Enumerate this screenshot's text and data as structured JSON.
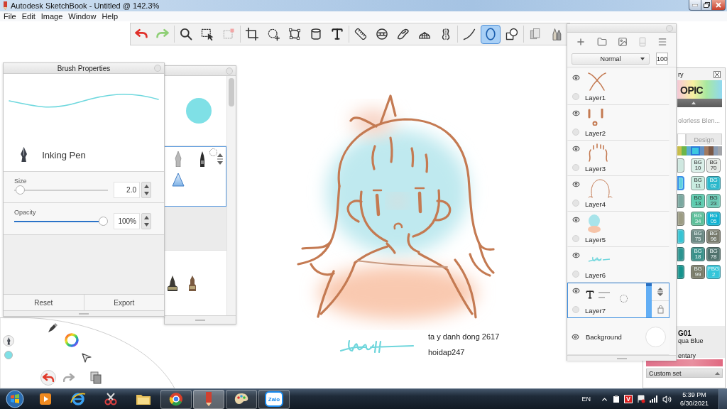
{
  "window": {
    "title": "Autodesk SketchBook - Untitled @ 142.3%"
  },
  "menu": [
    "File",
    "Edit",
    "Image",
    "Window",
    "Help"
  ],
  "toolbar": {
    "tools": [
      {
        "kind": "undo",
        "selected": false
      },
      {
        "kind": "redo",
        "selected": false
      },
      {
        "kind": "zoom",
        "selected": false
      },
      {
        "kind": "select",
        "selected": false
      },
      {
        "kind": "deselect",
        "selected": false
      },
      {
        "kind": "crop",
        "selected": false
      },
      {
        "kind": "transform",
        "selected": false
      },
      {
        "kind": "distort",
        "selected": false
      },
      {
        "kind": "cylinder",
        "selected": false
      },
      {
        "kind": "text",
        "selected": false
      },
      {
        "kind": "ruler",
        "selected": false
      },
      {
        "kind": "guide",
        "selected": false
      },
      {
        "kind": "curve",
        "selected": false
      },
      {
        "kind": "perspective",
        "selected": false
      },
      {
        "kind": "symmetry",
        "selected": false
      },
      {
        "kind": "stroke",
        "selected": false
      },
      {
        "kind": "ellipse",
        "selected": true
      },
      {
        "kind": "shapes",
        "selected": false
      },
      {
        "kind": "markers",
        "selected": false
      },
      {
        "kind": "brushes",
        "selected": false
      }
    ]
  },
  "brush_properties": {
    "title": "Brush Properties",
    "brush": "Inking Pen",
    "size": {
      "label": "Size",
      "value": "2.0",
      "level": 0.02
    },
    "opacity": {
      "label": "Opacity",
      "value": "100%",
      "level": 1
    },
    "buttons": [
      "Reset",
      "Export"
    ]
  },
  "layers": {
    "blend_mode": "Normal",
    "opacity": "100",
    "items": [
      {
        "kind": "bow",
        "name": "Layer1",
        "visible": true,
        "selected": false
      },
      {
        "kind": "face",
        "name": "Layer2",
        "visible": true,
        "selected": false
      },
      {
        "kind": "bangs",
        "name": "Layer3",
        "visible": true,
        "selected": false
      },
      {
        "kind": "outline",
        "name": "Layer4",
        "visible": true,
        "selected": false
      },
      {
        "kind": "color",
        "name": "Layer5",
        "visible": true,
        "selected": false
      },
      {
        "kind": "signature",
        "name": "Layer6",
        "visible": true,
        "selected": false
      },
      {
        "kind": "text",
        "name": "Layer7",
        "visible": true,
        "selected": true
      },
      {
        "kind": "background",
        "name": "Background",
        "visible": true,
        "selected": false
      }
    ]
  },
  "color_library": {
    "title": "ry",
    "logo": "OPIC",
    "subtitle": "olorless Blen...",
    "tabs": [
      {
        "selected": true
      },
      {
        "label": "Design",
        "selected": false
      }
    ],
    "strip": [
      {
        "color": "#c9be4c",
        "selected": false
      },
      {
        "color": "#6cb64a",
        "selected": false
      },
      {
        "color": "#5aaed0",
        "selected": false
      },
      {
        "color": "#3cc8e0",
        "selected": true
      },
      {
        "color": "#6290c2",
        "selected": false
      },
      {
        "color": "#a27a60",
        "selected": false
      },
      {
        "color": "#7a5846",
        "selected": false
      },
      {
        "color": "#8c9cb2",
        "selected": false
      },
      {
        "color": "#a2a4a8",
        "selected": false
      }
    ],
    "swatches": [
      {
        "color": "#cfe8e0",
        "selected": false
      },
      {
        "code": "BG",
        "number": "10",
        "color": "#d9efe8",
        "selected": false
      },
      {
        "code": "BG",
        "number": "70",
        "color": "#e4e9e5",
        "selected": false
      },
      {
        "color": "#5fd0e0",
        "selected": true
      },
      {
        "code": "BG",
        "number": "11",
        "color": "#c8ece0",
        "selected": false
      },
      {
        "code": "BG",
        "number": "02",
        "color": "#2ab8cc",
        "selected": false
      },
      {
        "color": "#7aa8a0",
        "selected": false
      },
      {
        "code": "BG",
        "number": "13",
        "color": "#5dcdb0",
        "selected": false
      },
      {
        "code": "BG",
        "number": "23",
        "color": "#6ccab5",
        "selected": false
      },
      {
        "color": "#9c9c84",
        "selected": false
      },
      {
        "code": "BG",
        "number": "34",
        "color": "#5cbf9a",
        "selected": false
      },
      {
        "code": "BG",
        "number": "05",
        "color": "#0fb2d2",
        "selected": false
      },
      {
        "color": "#36c4d4",
        "selected": false
      },
      {
        "code": "BG",
        "number": "75",
        "color": "#6a8883",
        "selected": false
      },
      {
        "code": "BG",
        "number": "96",
        "color": "#787a6c",
        "selected": false
      },
      {
        "color": "#2b9490",
        "selected": false
      },
      {
        "code": "BG",
        "number": "18",
        "color": "#3a918a",
        "selected": false
      },
      {
        "code": "BG",
        "number": "78",
        "color": "#4f716c",
        "selected": false
      },
      {
        "color": "#15938d",
        "selected": false
      },
      {
        "code": "BG",
        "number": "99",
        "color": "#7b7d6b",
        "selected": false
      },
      {
        "code": "FBG",
        "number": "2",
        "color": "#33c6da",
        "selected": false
      }
    ],
    "current": {
      "code": "G01",
      "name": "qua Blue",
      "scheme": "entary",
      "set": "Custom set"
    }
  },
  "canvas": {
    "texts": [
      "ta y danh dong 2617",
      "hoidap247"
    ]
  },
  "taskbar": {
    "apps": [
      {
        "kind": "media",
        "running": false,
        "selected": false
      },
      {
        "kind": "browser",
        "running": false,
        "selected": false
      },
      {
        "kind": "scissors",
        "running": false,
        "selected": false
      },
      {
        "kind": "files",
        "running": false,
        "selected": false
      },
      {
        "kind": "chrome",
        "running": true,
        "selected": false
      },
      {
        "kind": "sketch",
        "running": true,
        "selected": true
      },
      {
        "kind": "paint",
        "running": true,
        "selected": false
      },
      {
        "kind": "chat",
        "label": "Zalo",
        "running": true,
        "selected": false
      }
    ],
    "language": "EN",
    "tray": [
      {
        "kind": "clipboard"
      },
      {
        "kind": "input",
        "label": "V"
      },
      {
        "kind": "flag"
      },
      {
        "kind": "signal"
      },
      {
        "kind": "volume"
      }
    ],
    "time": "5:39 PM",
    "date": "6/30/2021"
  }
}
